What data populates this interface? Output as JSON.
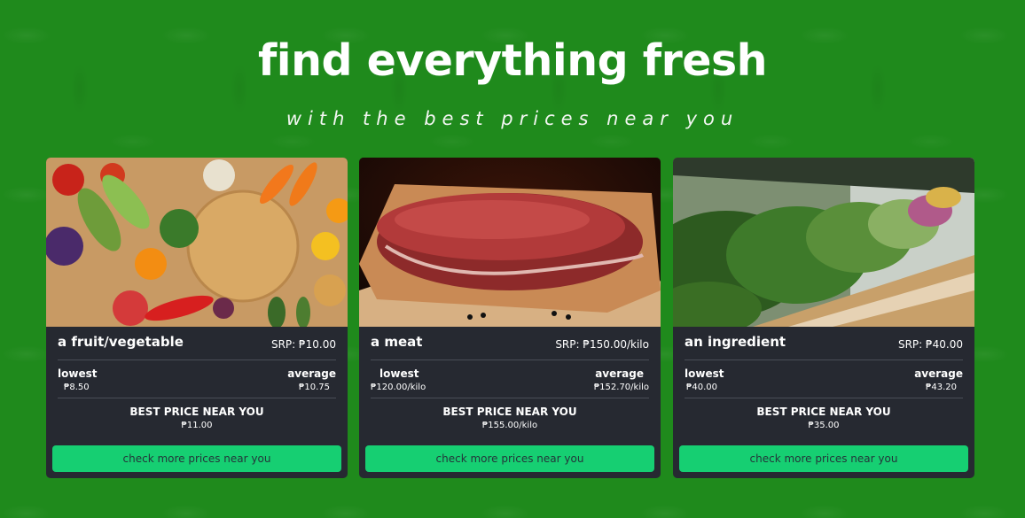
{
  "hero": {
    "title": "find everything fresh",
    "subtitle": "with the best prices near you"
  },
  "colors": {
    "background": "#1f8a1c",
    "card": "#262931",
    "button": "#16cf72"
  },
  "cards": [
    {
      "name": "a fruit/vegetable",
      "srp": "SRP: ₱10.00",
      "lowest_label": "lowest",
      "lowest_value": "₱8.50",
      "average_label": "average",
      "average_value": "₱10.75",
      "best_label": "BEST PRICE NEAR YOU",
      "best_value": "₱11.00",
      "button_label": "check more prices near you"
    },
    {
      "name": "a meat",
      "srp": "SRP: ₱150.00/kilo",
      "lowest_label": "lowest",
      "lowest_value": "₱120.00/kilo",
      "average_label": "average",
      "average_value": "₱152.70/kilo",
      "best_label": "BEST PRICE NEAR YOU",
      "best_value": "₱155.00/kilo",
      "button_label": "check more prices near you"
    },
    {
      "name": "an ingredient",
      "srp": "SRP: ₱40.00",
      "lowest_label": "lowest",
      "lowest_value": "₱40.00",
      "average_label": "average",
      "average_value": "₱43.20",
      "best_label": "BEST PRICE NEAR YOU",
      "best_value": "₱35.00",
      "button_label": "check more prices near you"
    }
  ]
}
